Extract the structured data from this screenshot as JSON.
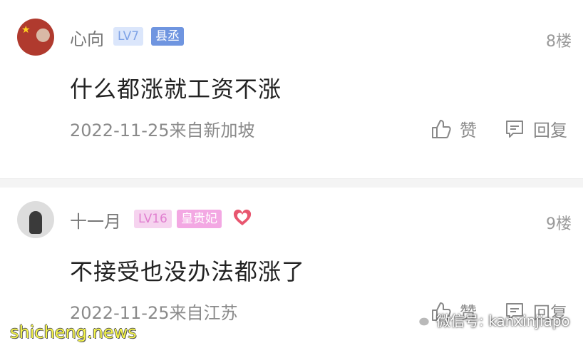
{
  "comments": [
    {
      "username": "心向",
      "level": "LV7",
      "title": "县丞",
      "floor": "8楼",
      "text": "什么都涨就工资不涨",
      "meta": "2022-11-25来自新加坡",
      "like_label": "赞",
      "reply_label": "回复"
    },
    {
      "username": "十一月",
      "level": "LV16",
      "title": "皇贵妃",
      "floor": "9楼",
      "text": "不接受也没办法都涨了",
      "meta": "2022-11-25来自江苏",
      "like_label": "赞",
      "reply_label": "回复"
    }
  ],
  "watermarks": {
    "left": "shicheng.news",
    "right": "微信号: kanxinjiapo"
  },
  "icons": [
    "thumbs-up-icon",
    "reply-icon",
    "heart-icon",
    "wechat-icon"
  ],
  "colors": {
    "lv7_badge": "#6f95e0",
    "lv16_badge": "#f3a8e3",
    "heart": "#e8566f"
  }
}
